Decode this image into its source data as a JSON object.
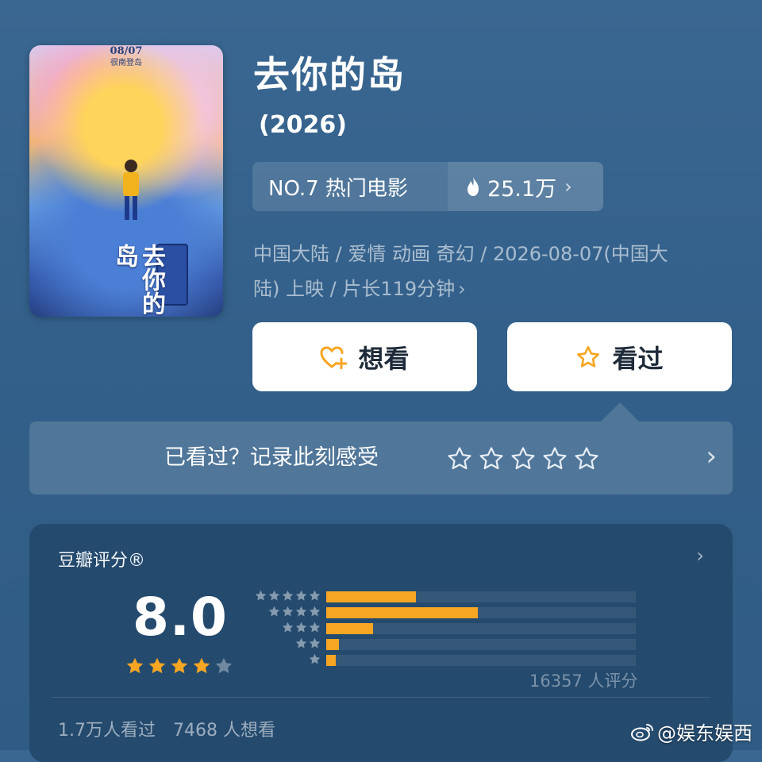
{
  "poster": {
    "date": "08/07",
    "subtitle": "很南登岛",
    "title": "去你的岛"
  },
  "movie": {
    "title": "去你的岛",
    "year": "(2026)"
  },
  "rank": {
    "label": "NO.7 热门电影",
    "heat": "25.1万",
    "chevron": "›"
  },
  "meta": {
    "line1": "中国大陆 / 爱情 动画 奇幻 / 2026-08-07(中国大",
    "line2": "陆) 上映 / 片长119分钟",
    "chevron": "›"
  },
  "buttons": {
    "want": "想看",
    "seen": "看过"
  },
  "feel": {
    "prompt": "已看过？记录此刻感受",
    "chevron": "›",
    "stars": 5
  },
  "rating": {
    "label": "豆瓣评分®",
    "score": "8.0",
    "stars_filled": 4,
    "stars_total": 5,
    "distribution": [
      {
        "stars": 5,
        "percent": 29
      },
      {
        "stars": 4,
        "percent": 49
      },
      {
        "stars": 3,
        "percent": 15
      },
      {
        "stars": 2,
        "percent": 4
      },
      {
        "stars": 1,
        "percent": 3
      }
    ],
    "count": "16357 人评分",
    "watched": "1.7万人看过",
    "wanted": "7468 人想看",
    "chevron": "›"
  },
  "watermark": {
    "text": "@娱东娱西"
  },
  "colors": {
    "accent": "#f6a623",
    "background": "#33608a"
  }
}
